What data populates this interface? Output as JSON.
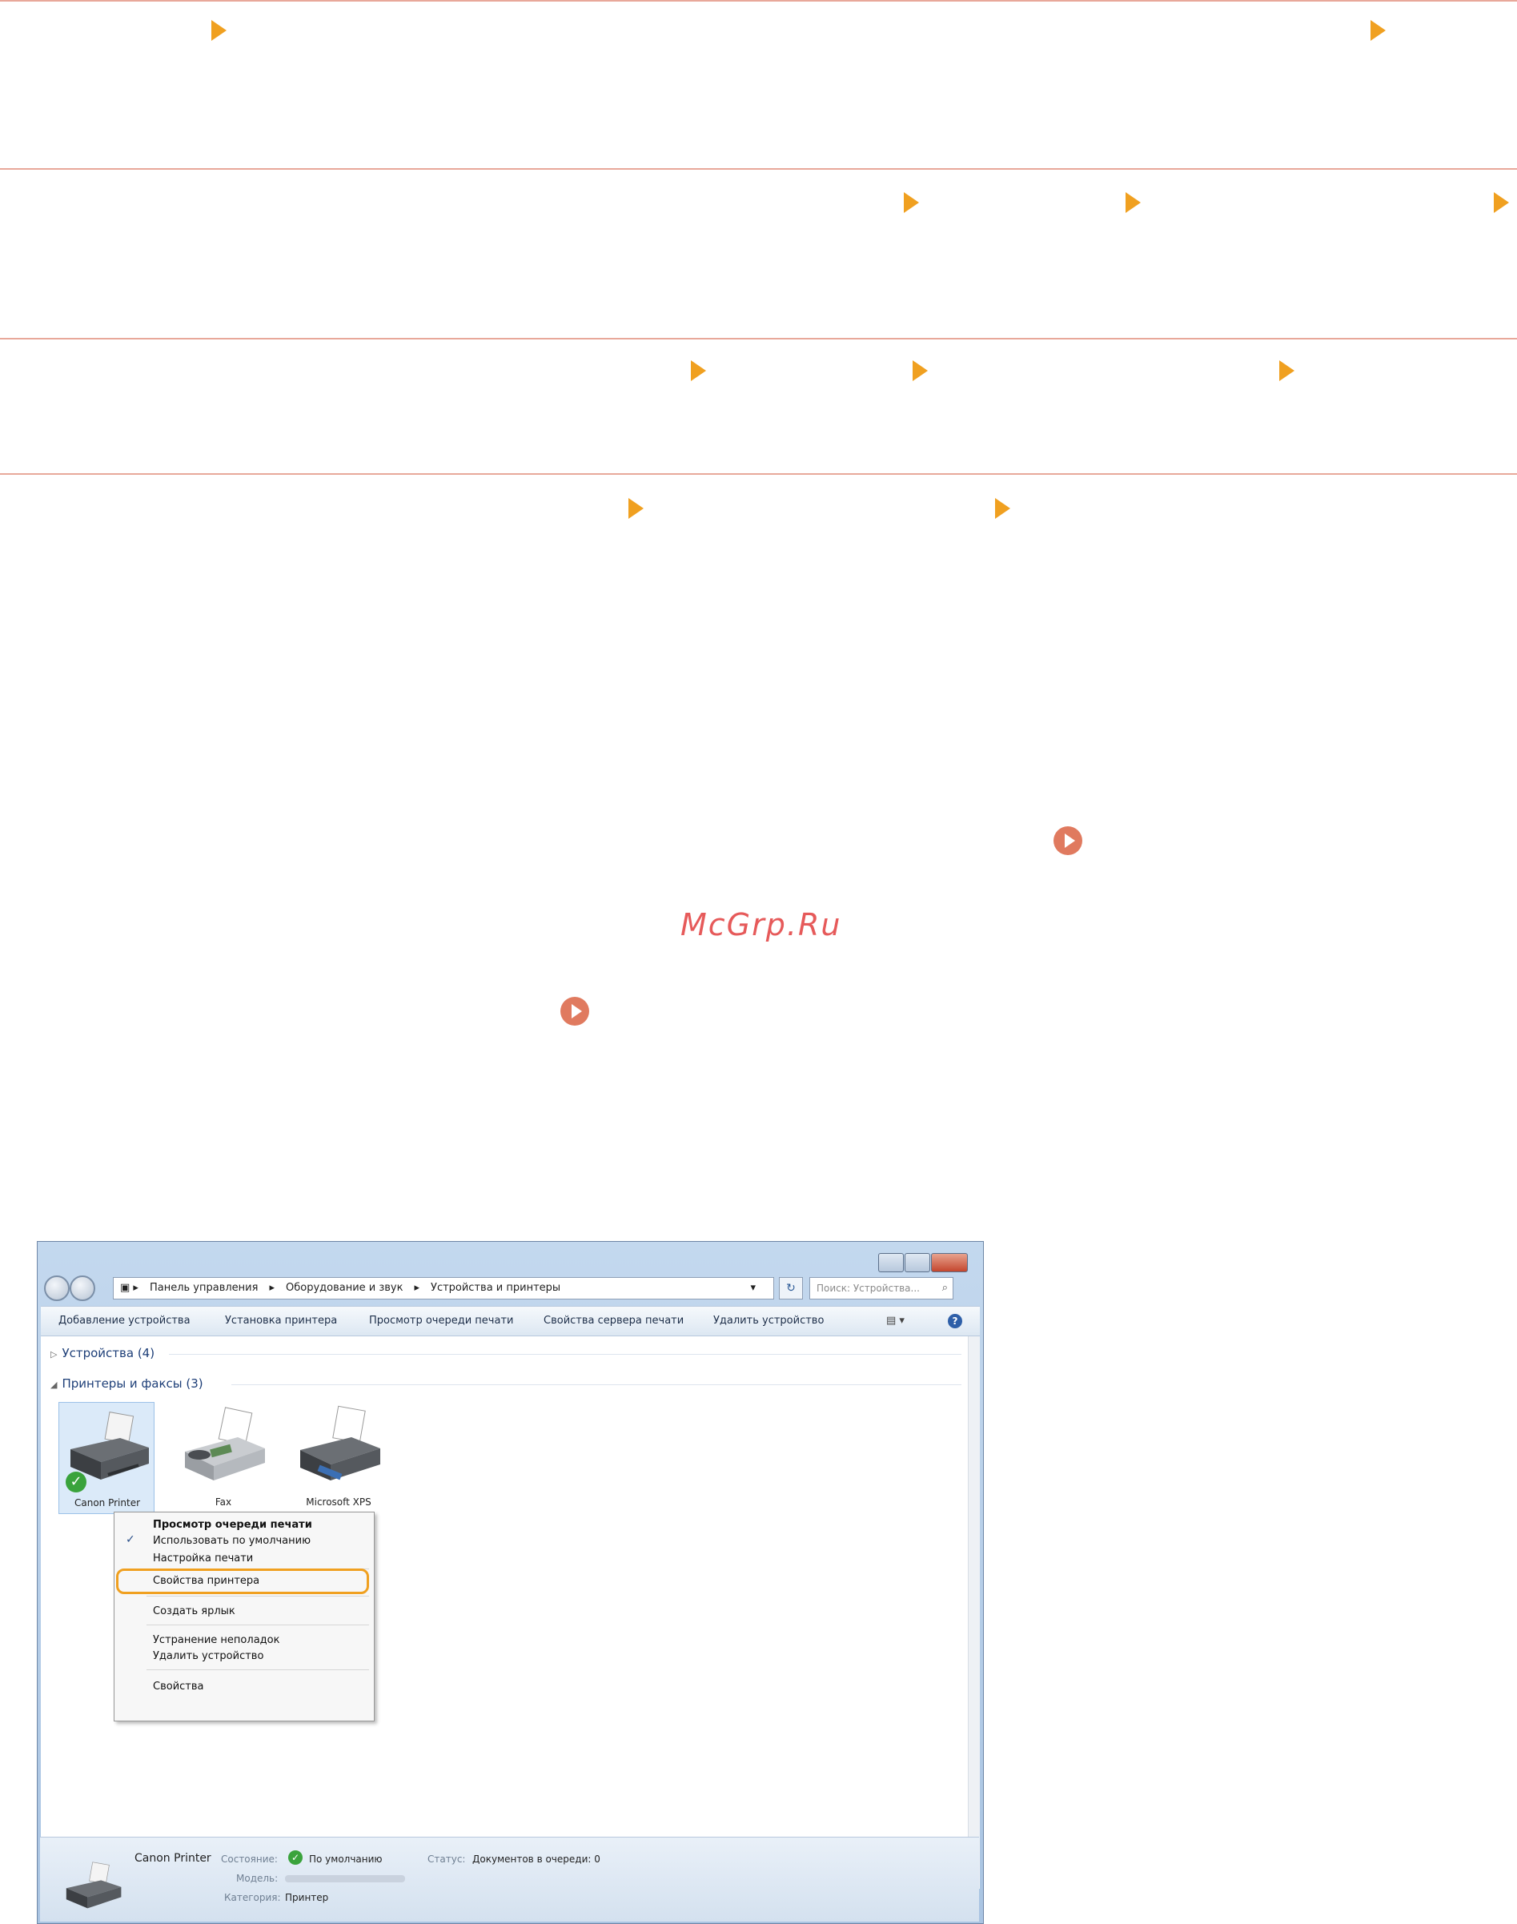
{
  "watermark": "McGrp.Ru",
  "window": {
    "address": {
      "crumbs": [
        "Панель управления",
        "Оборудование и звук",
        "Устройства и принтеры"
      ]
    },
    "search_placeholder": "Поиск: Устройства...",
    "toolbar": {
      "items": [
        "Добавление устройства",
        "Установка принтера",
        "Просмотр очереди печати",
        "Свойства сервера печати",
        "Удалить устройство"
      ]
    },
    "groups": {
      "devices": "Устройства (4)",
      "printers": "Принтеры и факсы (3)"
    },
    "devices": [
      {
        "label": "Canon Printer",
        "selected": true,
        "status_icon": "check-icon"
      },
      {
        "label": "Fax",
        "selected": false
      },
      {
        "label": "Microsoft XPS",
        "selected": false
      }
    ],
    "context_menu": {
      "items": [
        {
          "label": "Просмотр очереди печати",
          "bold": true
        },
        {
          "label": "Использовать по умолчанию",
          "checked": true
        },
        {
          "label": "Настройка печати"
        },
        {
          "label": "Свойства принтера",
          "highlighted": true
        },
        {
          "label": "Создать ярлык"
        },
        {
          "label": "Устранение неполадок"
        },
        {
          "label": "Удалить устройство"
        },
        {
          "label": "Свойства"
        }
      ]
    },
    "details": {
      "name": "Canon Printer",
      "state_label": "Состояние:",
      "state_value": "По умолчанию",
      "status_label": "Статус:",
      "status_value": "Документов в очереди: 0",
      "model_label": "Модель:",
      "category_label": "Категория:",
      "category_value": "Принтер"
    }
  },
  "colors": {
    "rule": "#e8a89a",
    "arrow": "#f0a020",
    "play_circle": "#e07a5f",
    "highlight": "#f0a020"
  }
}
